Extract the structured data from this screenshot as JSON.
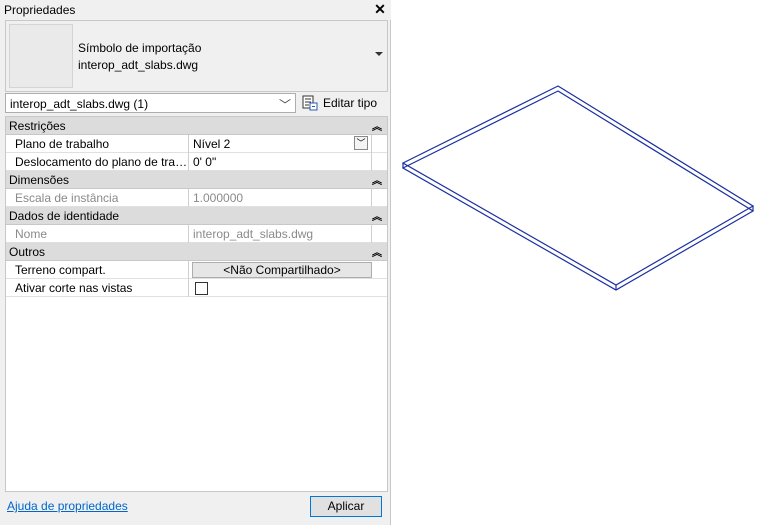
{
  "panel": {
    "title": "Propriedades",
    "type_selector": {
      "line1": "Símbolo de importação",
      "line2": "interop_adt_slabs.dwg"
    },
    "instance_filter": "interop_adt_slabs.dwg (1)",
    "edit_type_label": "Editar tipo"
  },
  "groups": [
    {
      "label": "Restrições",
      "rows": [
        {
          "name": "Plano de trabalho",
          "value": "Nível 2"
        },
        {
          "name": "Deslocamento do plano de trab...",
          "value": "0'  0\""
        }
      ]
    },
    {
      "label": "Dimensões",
      "rows": [
        {
          "name": "Escala de instância",
          "value": "1.000000"
        }
      ]
    },
    {
      "label": "Dados de identidade",
      "rows": [
        {
          "name": "Nome",
          "value": "interop_adt_slabs.dwg"
        }
      ]
    },
    {
      "label": "Outros",
      "rows": [
        {
          "name": "Terreno compart.",
          "value": "<Não Compartilhado>"
        },
        {
          "name": "Ativar corte nas vistas",
          "value": ""
        }
      ]
    }
  ],
  "footer": {
    "help_link": "Ajuda de propriedades",
    "apply_button": "Aplicar"
  },
  "colors": {
    "panel_bg": "#f0f0f0",
    "category_bg": "#dcdcdc",
    "model_edge": "#1a2fa3",
    "link": "#0066cc",
    "focus": "#0078d7"
  },
  "icons": [
    "close-icon",
    "dropdown-arrow-icon",
    "chevron-down-icon",
    "edit-type-icon",
    "collapse-icon"
  ]
}
